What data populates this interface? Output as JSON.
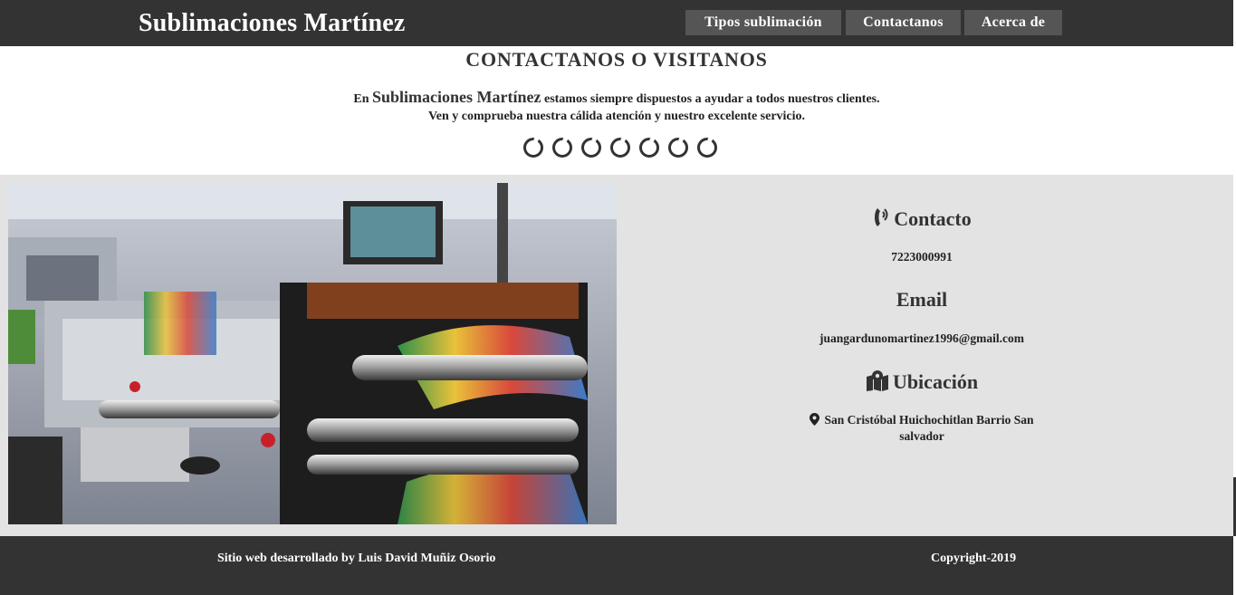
{
  "navbar": {
    "brand": "Sublimaciones Martínez",
    "links": [
      "Tipos sublimación",
      "Contactanos",
      "Acerca de"
    ]
  },
  "intro": {
    "title": "CONTACTANOS O VISITANOS",
    "line1_prefix": "En",
    "line1_brand": "Sublimaciones Martínez",
    "line1_suffix": "estamos siempre dispuestos a ayudar a todos nuestros clientes.",
    "line2": "Ven y comprueba nuestra cálida atención y nuestro excelente servicio.",
    "loader_icon": "circle-notch-icon"
  },
  "photo": {
    "alt_icon": "printing-press-photo"
  },
  "contact": {
    "phone_title": "Contacto",
    "phone_icon": "phone-volume-icon",
    "phone": "7223000991",
    "email_title": "Email",
    "email": "juangardunomartinez1996@gmail.com",
    "location_title": "Ubicación",
    "location_icon": "map-marked-icon",
    "address_icon": "map-marker-icon",
    "address_line1": "San Cristóbal Huichochitlan Barrio San",
    "address_line2": "salvador"
  },
  "footer": {
    "credit": "Sitio web desarrollado by Luis David Muñiz Osorio",
    "copyright": "Copyright-2019"
  },
  "colors": {
    "dark": "#333333",
    "nav_button": "#555555",
    "content_bg": "#e3e3e3"
  }
}
